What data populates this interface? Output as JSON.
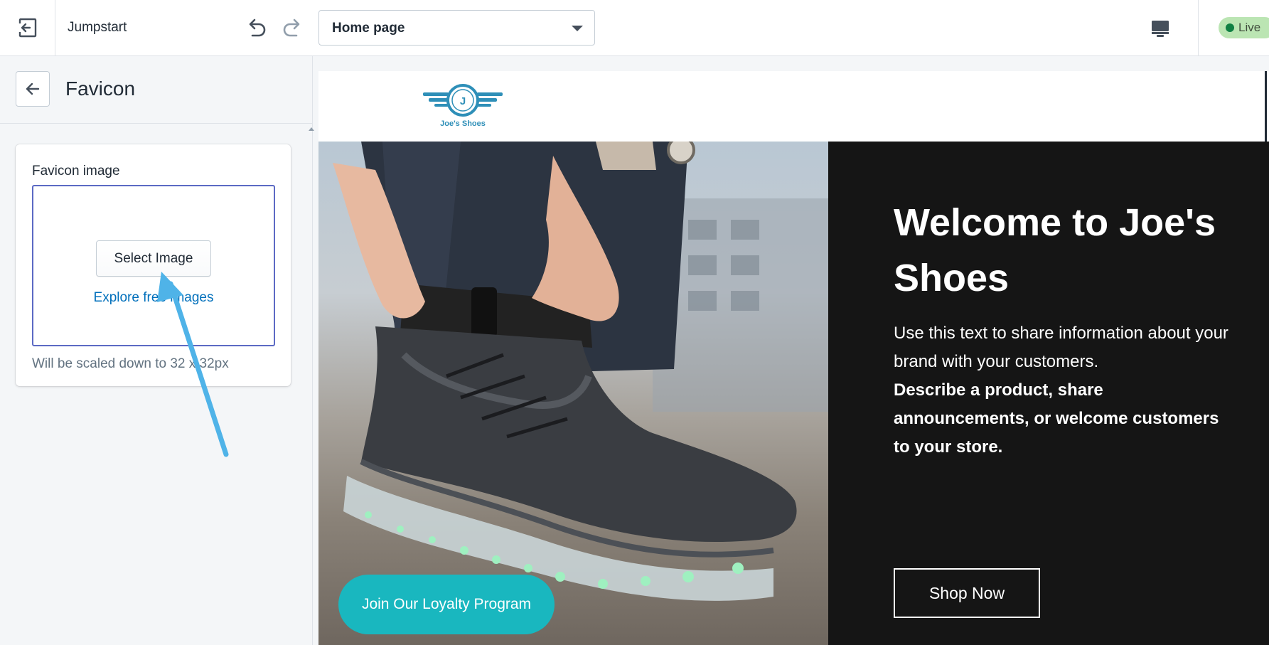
{
  "topbar": {
    "exit_icon": "exit-icon",
    "theme_name": "Jumpstart",
    "undo_icon": "undo-icon",
    "redo_icon": "redo-icon",
    "page_select_value": "Home page",
    "device_icon": "desktop-icon",
    "status_badge": "Live"
  },
  "sidebar": {
    "back_icon": "arrow-left-icon",
    "title": "Favicon",
    "field_label": "Favicon image",
    "select_button": "Select Image",
    "explore_link": "Explore free images",
    "help_text": "Will be scaled down to 32 x 32px"
  },
  "preview": {
    "logo_letter": "J",
    "logo_text": "Joe's Shoes",
    "hero_title": "Welcome to Joe's Shoes",
    "hero_text": "Use this text to share information about your brand with your customers.",
    "hero_bold": "Describe a product, share announcements, or welcome customers to your store.",
    "shop_button": "Shop Now",
    "loyalty_button": "Join Our Loyalty Program"
  },
  "colors": {
    "accent_border": "#5c6ac4",
    "link": "#006fbb",
    "live_badge": "#bbe5b3",
    "loyalty_teal": "#19b7bf",
    "arrow": "#4fb3e8",
    "hero_panel": "#151515"
  }
}
